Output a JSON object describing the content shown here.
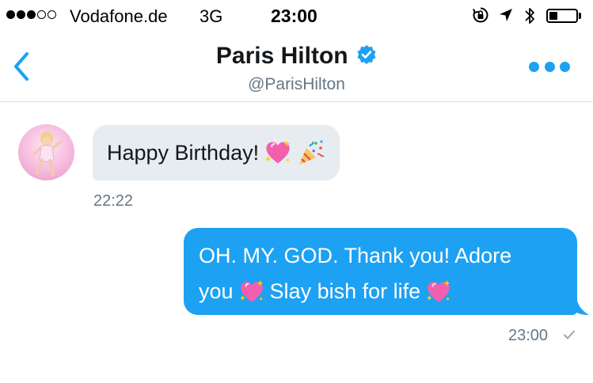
{
  "status_bar": {
    "signal_bars_filled": 3,
    "signal_bars_total": 5,
    "carrier": "Vodafone.de",
    "network": "3G",
    "time": "23:00",
    "battery_level": 0.3,
    "icons": [
      "orientation-lock-icon",
      "location-arrow-icon",
      "bluetooth-icon",
      "battery-icon"
    ]
  },
  "header": {
    "back_icon": "chevron-left-icon",
    "contact_name": "Paris Hilton",
    "verified": true,
    "handle": "@ParisHilton",
    "more_icon": "more-dots-icon",
    "accent_color": "#1da1f2"
  },
  "conversation": {
    "messages": [
      {
        "direction": "incoming",
        "text": "Happy Birthday!",
        "emojis": [
          "sparkling-heart",
          "party-popper"
        ],
        "time": "22:22"
      },
      {
        "direction": "outgoing",
        "lines": [
          "OH. MY. GOD. Thank you! Adore",
          "you",
          "Slay bish for life"
        ],
        "emojis": [
          "sparkling-heart",
          "sparkling-heart"
        ],
        "time": "23:00",
        "status_icon": "sent-check-icon"
      }
    ]
  }
}
